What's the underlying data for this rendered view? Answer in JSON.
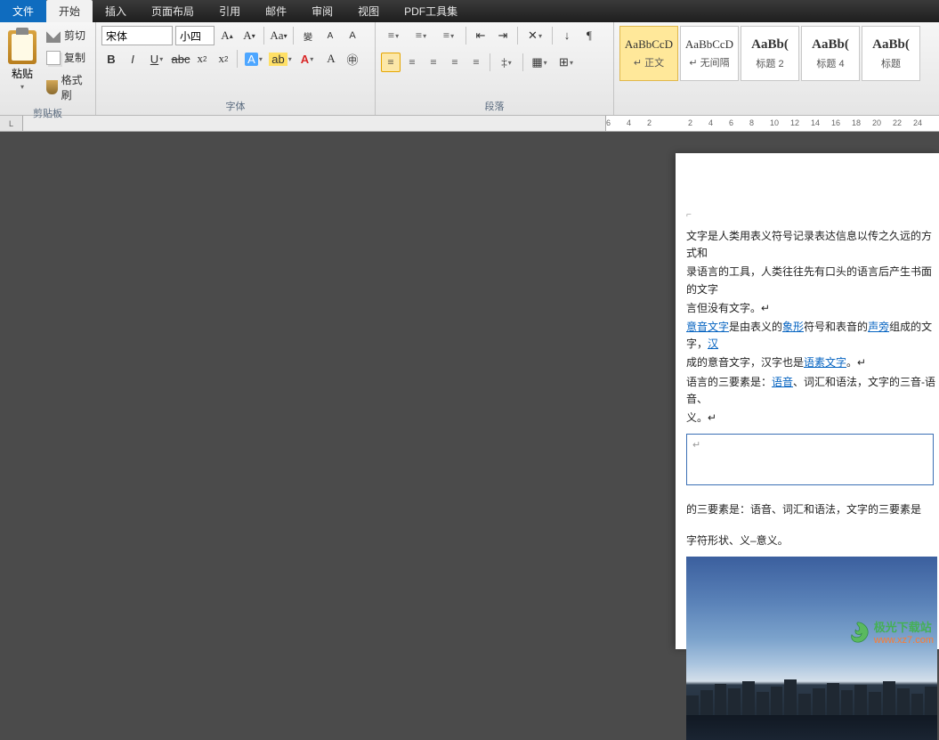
{
  "menu": {
    "file": "文件",
    "tabs": [
      "开始",
      "插入",
      "页面布局",
      "引用",
      "邮件",
      "审阅",
      "视图",
      "PDF工具集"
    ]
  },
  "clipboard": {
    "paste": "粘贴",
    "cut": "剪切",
    "copy": "复制",
    "brush": "格式刷",
    "label": "剪贴板"
  },
  "font": {
    "name": "宋体",
    "size": "小四",
    "label": "字体"
  },
  "paragraph": {
    "label": "段落"
  },
  "styles": [
    {
      "sample": "AaBbCcD",
      "name": "↵ 正文",
      "bold": false,
      "active": true
    },
    {
      "sample": "AaBbCcD",
      "name": "↵ 无间隔",
      "bold": false,
      "active": false
    },
    {
      "sample": "AaBb(",
      "name": "标题 2",
      "bold": true,
      "active": false
    },
    {
      "sample": "AaBb(",
      "name": "标题 4",
      "bold": true,
      "active": false
    },
    {
      "sample": "AaBb(",
      "name": "标题",
      "bold": true,
      "active": false
    }
  ],
  "ruler": {
    "marks": [
      "6",
      "4",
      "2",
      "",
      "2",
      "4",
      "6",
      "8",
      "10",
      "12",
      "14",
      "16",
      "18",
      "20",
      "22",
      "24"
    ]
  },
  "doc": {
    "p1a": "文字是人类用表义符号记录表达信息以传之久远的方式和",
    "p1b": "录语言的工具，人类往往先有口头的语言后产生书面的文字",
    "p1c": "言但没有文字。↵",
    "p2a": "意音文字",
    "p2b": "是由表义的",
    "p2c": "象形",
    "p2d": "符号和表音的",
    "p2e": "声旁",
    "p2f": "组成的文字，",
    "p2g": "汉",
    "p3a": "成的意音文字，汉字也是",
    "p3b": "语素文字",
    "p3c": "。↵",
    "p4a": "语言的三要素是：",
    "p4b": "语音",
    "p4c": "、词汇和语法，文字的三音-语音、",
    "p5": "义。↵",
    "box": "↵",
    "p6": "的三要素是：语音、词汇和语法，文字的三要素是",
    "p7": "字符形状、义–意义。"
  },
  "watermark": {
    "text": "极光下载站",
    "url": "www.xz7.com"
  }
}
